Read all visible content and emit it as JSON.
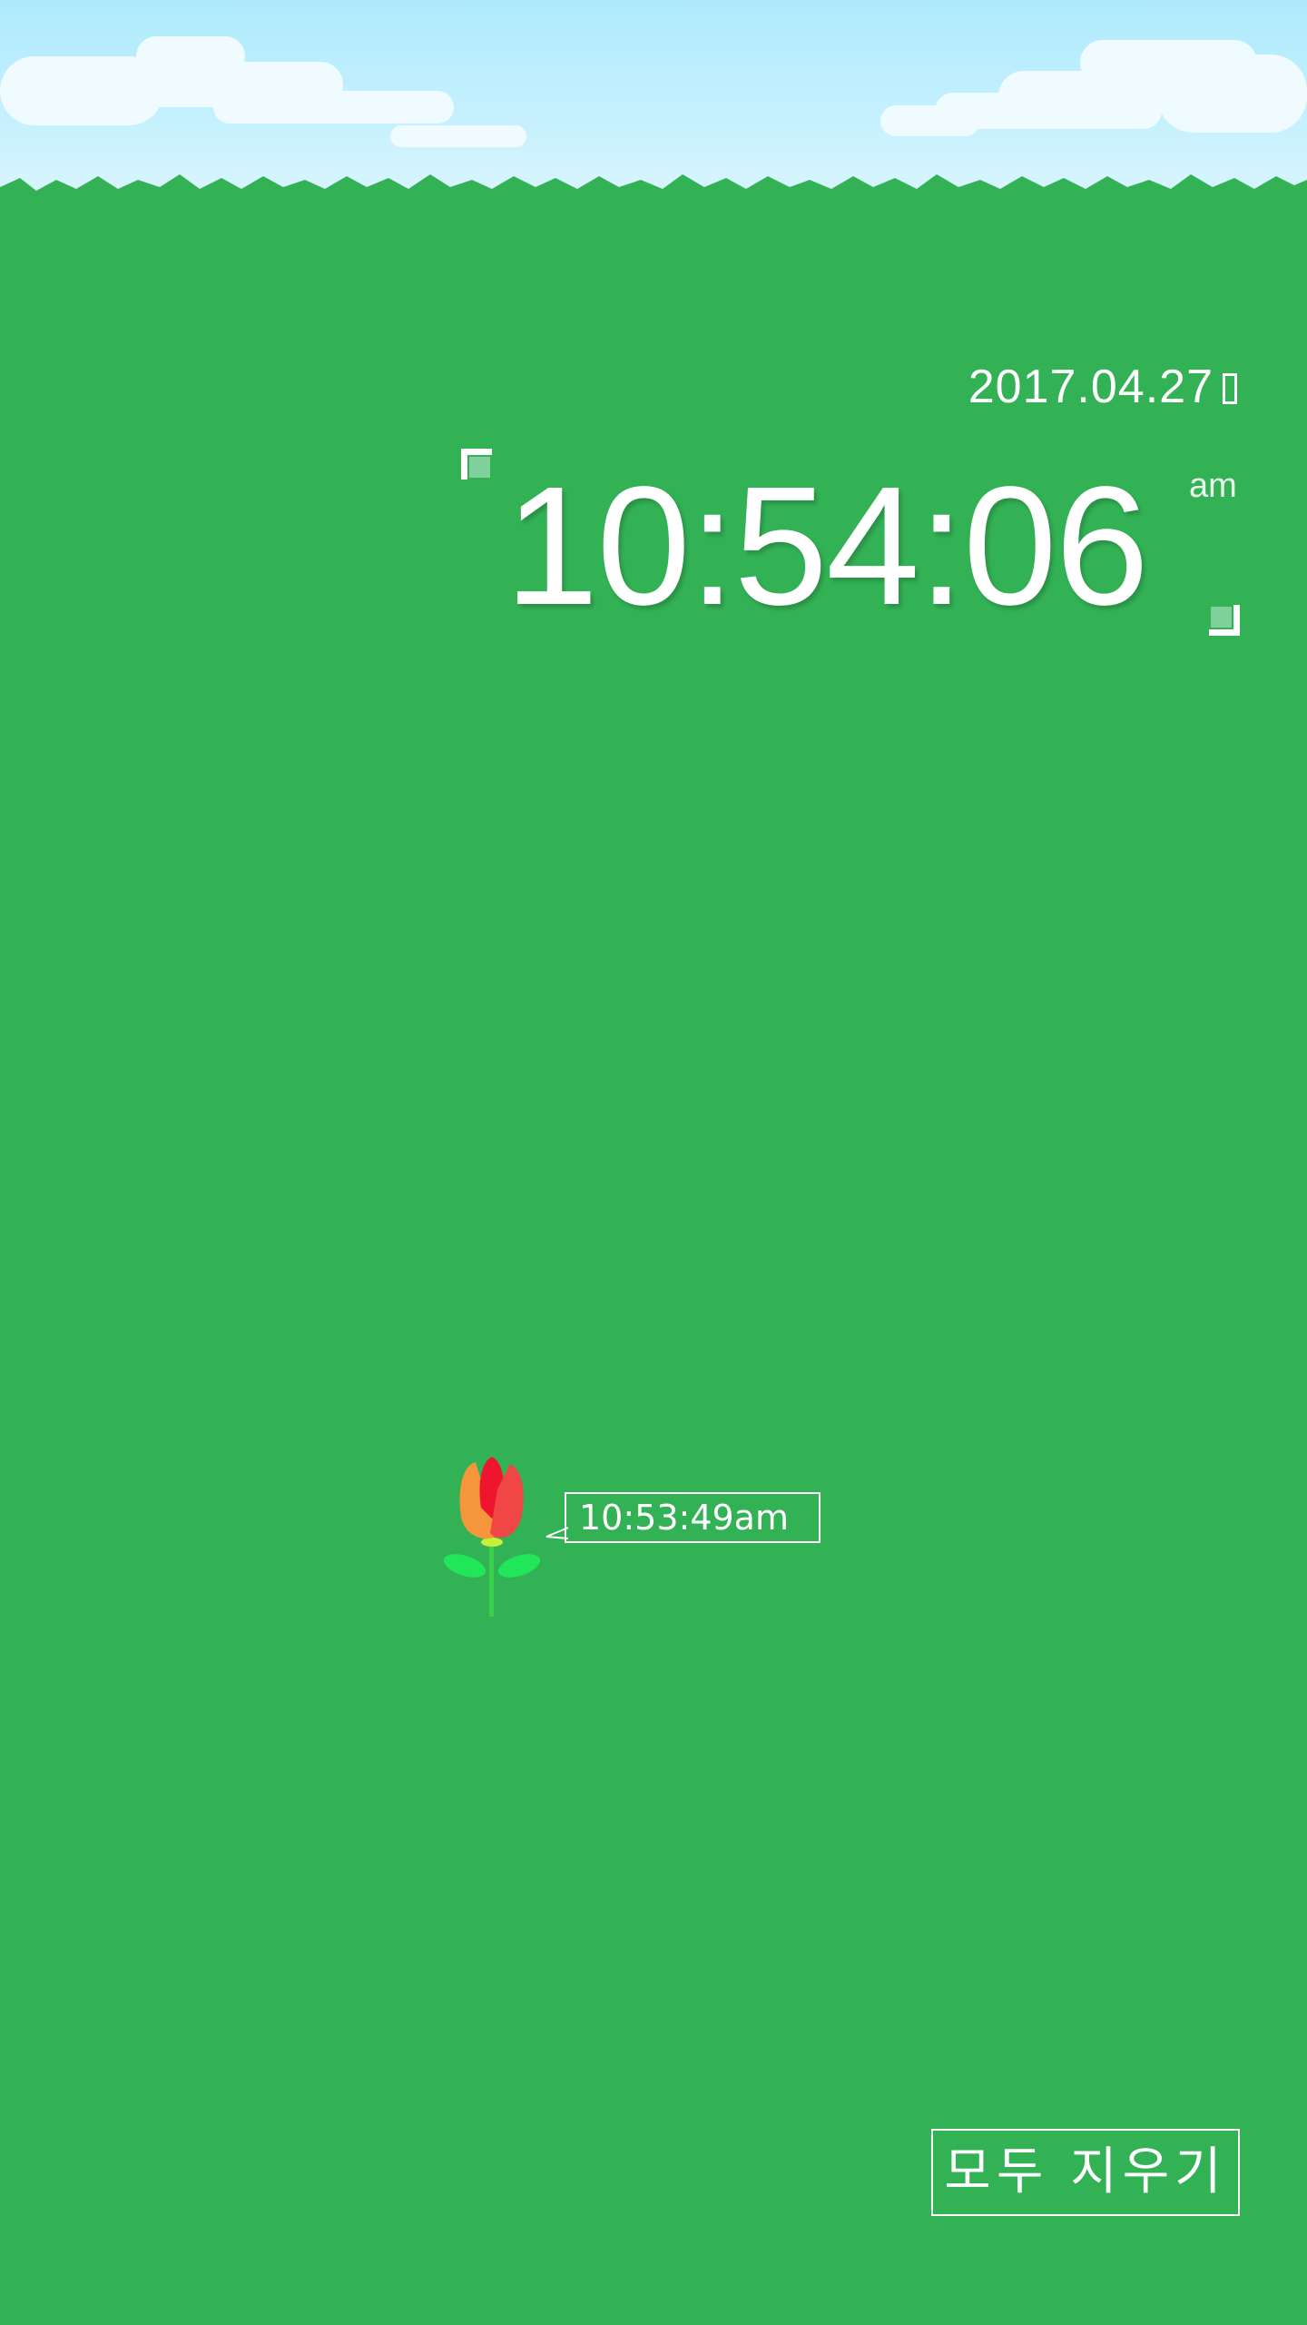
{
  "clock": {
    "date": "2017.04.27",
    "time": "10:54:06",
    "ampm": "am"
  },
  "marker": {
    "time_label": "10:53:49am"
  },
  "actions": {
    "clear_all_label": "모두 지우기"
  },
  "icons": {
    "flower": "tulip-icon"
  },
  "colors": {
    "grass": "#33b155",
    "sky_top": "#aeeafc",
    "text": "#ffffff"
  }
}
